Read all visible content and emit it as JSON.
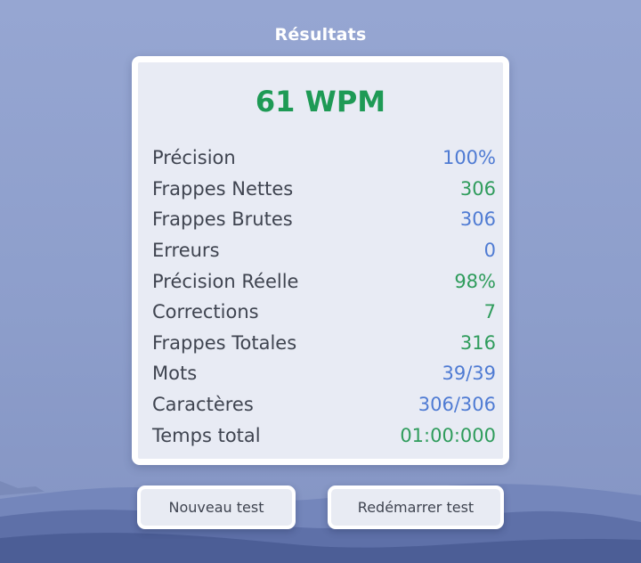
{
  "results": {
    "title": "Résultats",
    "wpm": "61 WPM",
    "stats": [
      {
        "label": "Précision",
        "value": "100%",
        "color": "#4f7bd3"
      },
      {
        "label": "Frappes Nettes",
        "value": "306",
        "color": "#2f9c5c"
      },
      {
        "label": "Frappes Brutes",
        "value": "306",
        "color": "#4f7bd3"
      },
      {
        "label": "Erreurs",
        "value": "0",
        "color": "#4f7bd3"
      },
      {
        "label": "Précision Réelle",
        "value": "98%",
        "color": "#2f9c5c"
      },
      {
        "label": "Corrections",
        "value": "7",
        "color": "#2f9c5c"
      },
      {
        "label": "Frappes Totales",
        "value": "316",
        "color": "#2f9c5c"
      },
      {
        "label": "Mots",
        "value": "39/39",
        "color": "#4f7bd3"
      },
      {
        "label": "Caractères",
        "value": "306/306",
        "color": "#4f7bd3"
      },
      {
        "label": "Temps total",
        "value": "01:00:000",
        "color": "#2f9c5c"
      }
    ]
  },
  "actions": {
    "new_test_label": "Nouveau test",
    "restart_label": "Redémarrer test"
  },
  "colors": {
    "wpm": "#1e9a55",
    "accent_blue": "#4f7bd3",
    "accent_green": "#2f9c5c",
    "card_bg": "#e8ebf4"
  }
}
